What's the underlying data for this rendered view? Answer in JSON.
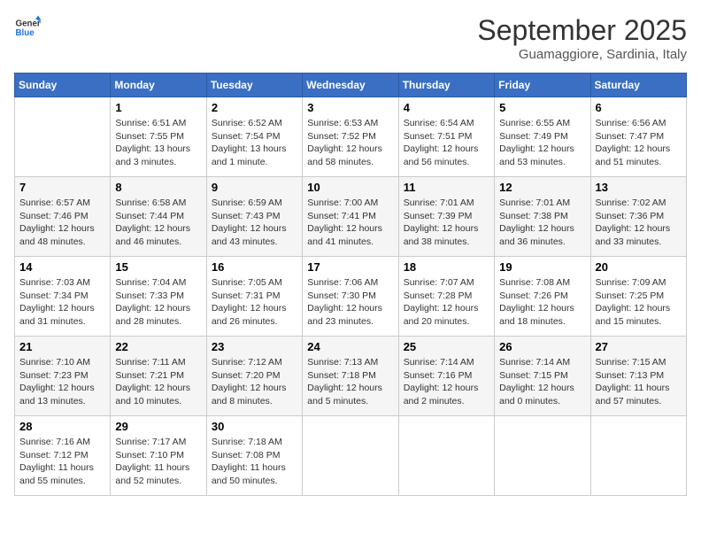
{
  "logo": {
    "line1": "General",
    "line2": "Blue"
  },
  "title": "September 2025",
  "location": "Guamaggiore, Sardinia, Italy",
  "days_of_week": [
    "Sunday",
    "Monday",
    "Tuesday",
    "Wednesday",
    "Thursday",
    "Friday",
    "Saturday"
  ],
  "weeks": [
    [
      {
        "day": "",
        "info": ""
      },
      {
        "day": "1",
        "info": "Sunrise: 6:51 AM\nSunset: 7:55 PM\nDaylight: 13 hours\nand 3 minutes."
      },
      {
        "day": "2",
        "info": "Sunrise: 6:52 AM\nSunset: 7:54 PM\nDaylight: 13 hours\nand 1 minute."
      },
      {
        "day": "3",
        "info": "Sunrise: 6:53 AM\nSunset: 7:52 PM\nDaylight: 12 hours\nand 58 minutes."
      },
      {
        "day": "4",
        "info": "Sunrise: 6:54 AM\nSunset: 7:51 PM\nDaylight: 12 hours\nand 56 minutes."
      },
      {
        "day": "5",
        "info": "Sunrise: 6:55 AM\nSunset: 7:49 PM\nDaylight: 12 hours\nand 53 minutes."
      },
      {
        "day": "6",
        "info": "Sunrise: 6:56 AM\nSunset: 7:47 PM\nDaylight: 12 hours\nand 51 minutes."
      }
    ],
    [
      {
        "day": "7",
        "info": "Sunrise: 6:57 AM\nSunset: 7:46 PM\nDaylight: 12 hours\nand 48 minutes."
      },
      {
        "day": "8",
        "info": "Sunrise: 6:58 AM\nSunset: 7:44 PM\nDaylight: 12 hours\nand 46 minutes."
      },
      {
        "day": "9",
        "info": "Sunrise: 6:59 AM\nSunset: 7:43 PM\nDaylight: 12 hours\nand 43 minutes."
      },
      {
        "day": "10",
        "info": "Sunrise: 7:00 AM\nSunset: 7:41 PM\nDaylight: 12 hours\nand 41 minutes."
      },
      {
        "day": "11",
        "info": "Sunrise: 7:01 AM\nSunset: 7:39 PM\nDaylight: 12 hours\nand 38 minutes."
      },
      {
        "day": "12",
        "info": "Sunrise: 7:01 AM\nSunset: 7:38 PM\nDaylight: 12 hours\nand 36 minutes."
      },
      {
        "day": "13",
        "info": "Sunrise: 7:02 AM\nSunset: 7:36 PM\nDaylight: 12 hours\nand 33 minutes."
      }
    ],
    [
      {
        "day": "14",
        "info": "Sunrise: 7:03 AM\nSunset: 7:34 PM\nDaylight: 12 hours\nand 31 minutes."
      },
      {
        "day": "15",
        "info": "Sunrise: 7:04 AM\nSunset: 7:33 PM\nDaylight: 12 hours\nand 28 minutes."
      },
      {
        "day": "16",
        "info": "Sunrise: 7:05 AM\nSunset: 7:31 PM\nDaylight: 12 hours\nand 26 minutes."
      },
      {
        "day": "17",
        "info": "Sunrise: 7:06 AM\nSunset: 7:30 PM\nDaylight: 12 hours\nand 23 minutes."
      },
      {
        "day": "18",
        "info": "Sunrise: 7:07 AM\nSunset: 7:28 PM\nDaylight: 12 hours\nand 20 minutes."
      },
      {
        "day": "19",
        "info": "Sunrise: 7:08 AM\nSunset: 7:26 PM\nDaylight: 12 hours\nand 18 minutes."
      },
      {
        "day": "20",
        "info": "Sunrise: 7:09 AM\nSunset: 7:25 PM\nDaylight: 12 hours\nand 15 minutes."
      }
    ],
    [
      {
        "day": "21",
        "info": "Sunrise: 7:10 AM\nSunset: 7:23 PM\nDaylight: 12 hours\nand 13 minutes."
      },
      {
        "day": "22",
        "info": "Sunrise: 7:11 AM\nSunset: 7:21 PM\nDaylight: 12 hours\nand 10 minutes."
      },
      {
        "day": "23",
        "info": "Sunrise: 7:12 AM\nSunset: 7:20 PM\nDaylight: 12 hours\nand 8 minutes."
      },
      {
        "day": "24",
        "info": "Sunrise: 7:13 AM\nSunset: 7:18 PM\nDaylight: 12 hours\nand 5 minutes."
      },
      {
        "day": "25",
        "info": "Sunrise: 7:14 AM\nSunset: 7:16 PM\nDaylight: 12 hours\nand 2 minutes."
      },
      {
        "day": "26",
        "info": "Sunrise: 7:14 AM\nSunset: 7:15 PM\nDaylight: 12 hours\nand 0 minutes."
      },
      {
        "day": "27",
        "info": "Sunrise: 7:15 AM\nSunset: 7:13 PM\nDaylight: 11 hours\nand 57 minutes."
      }
    ],
    [
      {
        "day": "28",
        "info": "Sunrise: 7:16 AM\nSunset: 7:12 PM\nDaylight: 11 hours\nand 55 minutes."
      },
      {
        "day": "29",
        "info": "Sunrise: 7:17 AM\nSunset: 7:10 PM\nDaylight: 11 hours\nand 52 minutes."
      },
      {
        "day": "30",
        "info": "Sunrise: 7:18 AM\nSunset: 7:08 PM\nDaylight: 11 hours\nand 50 minutes."
      },
      {
        "day": "",
        "info": ""
      },
      {
        "day": "",
        "info": ""
      },
      {
        "day": "",
        "info": ""
      },
      {
        "day": "",
        "info": ""
      }
    ]
  ]
}
